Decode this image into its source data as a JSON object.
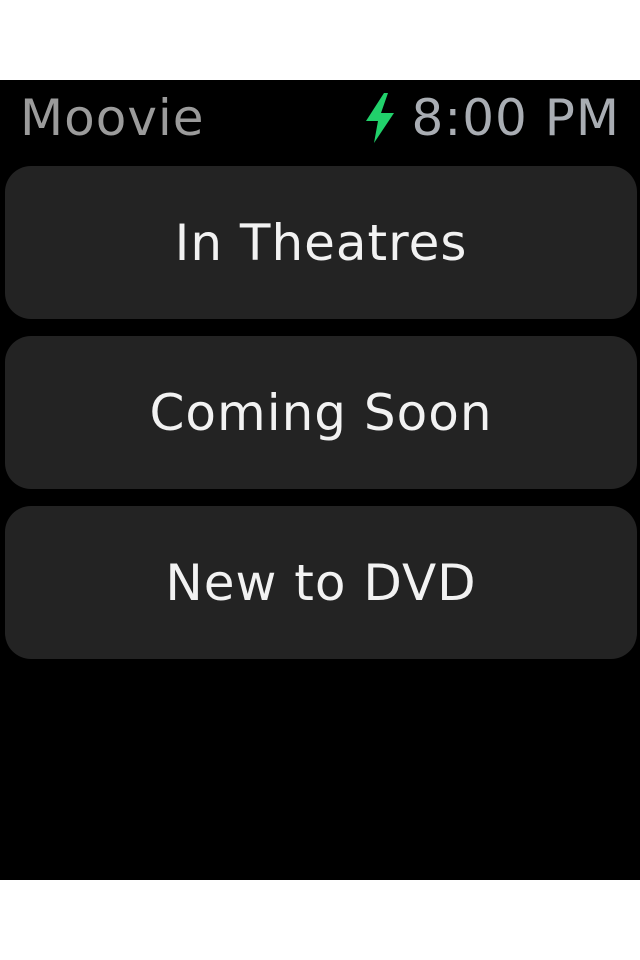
{
  "status_bar": {
    "app_title": "Moovie",
    "time": "8:00 PM",
    "charge_icon": "lightning-bolt-icon",
    "charge_color": "#21d16b"
  },
  "menu": {
    "items": [
      {
        "label": "In Theatres"
      },
      {
        "label": "Coming Soon"
      },
      {
        "label": "New to DVD"
      }
    ]
  },
  "colors": {
    "screen_background": "#000000",
    "button_background": "#232323",
    "button_text": "#f2f2f2",
    "title_text": "#9b9b9b"
  }
}
